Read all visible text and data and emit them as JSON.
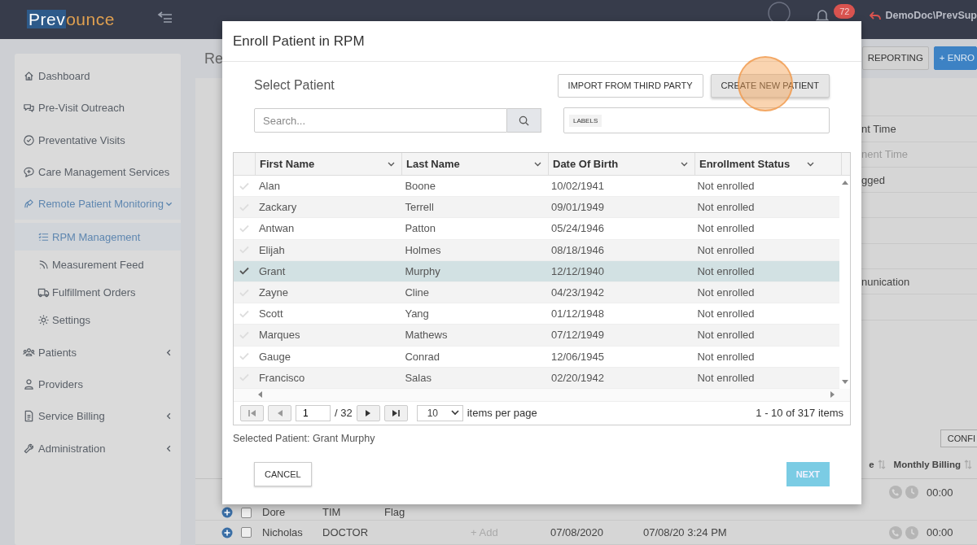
{
  "header": {
    "logo": {
      "part_1": "Prev",
      "part_2": "ounce"
    },
    "notification_count": "72",
    "user": "DemoDoc\\PrevSup"
  },
  "sidebar": {
    "items": [
      {
        "label": "Dashboard",
        "selected": false
      },
      {
        "label": "Pre-Visit Outreach",
        "selected": false
      },
      {
        "label": "Preventative Visits",
        "selected": false
      },
      {
        "label": "Care Management Services",
        "selected": false
      },
      {
        "label": "Remote Patient Monitoring",
        "selected": true,
        "expanded": true,
        "children": [
          {
            "label": "RPM Management",
            "selected": true
          },
          {
            "label": "Measurement Feed",
            "selected": false
          },
          {
            "label": "Fulfillment Orders",
            "selected": false
          },
          {
            "label": "Settings",
            "selected": false
          }
        ]
      },
      {
        "label": "Patients",
        "selected": false,
        "expanded": false
      },
      {
        "label": "Providers",
        "selected": false
      },
      {
        "label": "Service Billing",
        "selected": false,
        "expanded": false
      },
      {
        "label": "Administration",
        "selected": false,
        "expanded": false
      }
    ]
  },
  "page": {
    "title": "Re",
    "buttons": [
      {
        "label": "REPORTING",
        "kind": "default"
      },
      {
        "label": "+ ENRO",
        "kind": "primary"
      }
    ],
    "form_rows": [
      {
        "kind": "blank"
      },
      {
        "kind": "label",
        "text": "nt Time"
      },
      {
        "kind": "placeholder",
        "text": "nent Time"
      },
      {
        "kind": "value",
        "text": "gged"
      },
      {
        "kind": "blank"
      },
      {
        "kind": "blank"
      },
      {
        "kind": "blank"
      },
      {
        "kind": "value",
        "text": "nunication"
      },
      {
        "kind": "blank"
      }
    ],
    "config_button": "CONFI",
    "table": {
      "columns": [
        {
          "label": "e"
        },
        {
          "label": "Monthly Billing"
        }
      ],
      "rows": [
        {
          "checked": false,
          "column_1": "Dore",
          "column_2": "TIM",
          "column_3": "Flag",
          "billing": "00:00"
        },
        {
          "checked": false,
          "column_1": "Nicholas",
          "column_2": "DOCTOR",
          "column_4": "+ Add",
          "column_5": "07/08/2020",
          "column_6": "07/08/20 3:24 PM",
          "billing": "00:00"
        }
      ]
    }
  },
  "modal": {
    "title": "Enroll Patient in RPM",
    "section_title": "Select Patient",
    "buttons": [
      {
        "label": "IMPORT FROM THIRD PARTY"
      },
      {
        "label": "CREATE NEW PATIENT"
      }
    ],
    "search": {
      "placeholder": "Search..."
    },
    "labels_chip": "LABELS",
    "grid": {
      "columns": [
        "First Name",
        "Last Name",
        "Date Of Birth",
        "Enrollment Status"
      ],
      "rows": [
        {
          "first_name": "Alan",
          "last_name": "Boone",
          "dob": "10/02/1941",
          "status": "Not enrolled",
          "selected": false
        },
        {
          "first_name": "Zackary",
          "last_name": "Terrell",
          "dob": "09/01/1949",
          "status": "Not enrolled",
          "selected": false
        },
        {
          "first_name": "Antwan",
          "last_name": "Patton",
          "dob": "05/24/1946",
          "status": "Not enrolled",
          "selected": false
        },
        {
          "first_name": "Elijah",
          "last_name": "Holmes",
          "dob": "08/18/1946",
          "status": "Not enrolled",
          "selected": false
        },
        {
          "first_name": "Grant",
          "last_name": "Murphy",
          "dob": "12/12/1940",
          "status": "Not enrolled",
          "selected": true
        },
        {
          "first_name": "Zayne",
          "last_name": "Cline",
          "dob": "04/23/1942",
          "status": "Not enrolled",
          "selected": false
        },
        {
          "first_name": "Scott",
          "last_name": "Yang",
          "dob": "01/12/1948",
          "status": "Not enrolled",
          "selected": false
        },
        {
          "first_name": "Marques",
          "last_name": "Mathews",
          "dob": "07/12/1949",
          "status": "Not enrolled",
          "selected": false
        },
        {
          "first_name": "Gauge",
          "last_name": "Conrad",
          "dob": "12/06/1945",
          "status": "Not enrolled",
          "selected": false
        },
        {
          "first_name": "Francisco",
          "last_name": "Salas",
          "dob": "02/20/1942",
          "status": "Not enrolled",
          "selected": false
        }
      ]
    },
    "pager": {
      "page": "1",
      "total_pages": "/ 32",
      "page_size": "10",
      "page_size_label": "items per page",
      "summary": "1 - 10 of 317 items"
    },
    "selected_text": "Selected Patient: Grant Murphy",
    "cancel": "CANCEL",
    "next": "NEXT"
  }
}
